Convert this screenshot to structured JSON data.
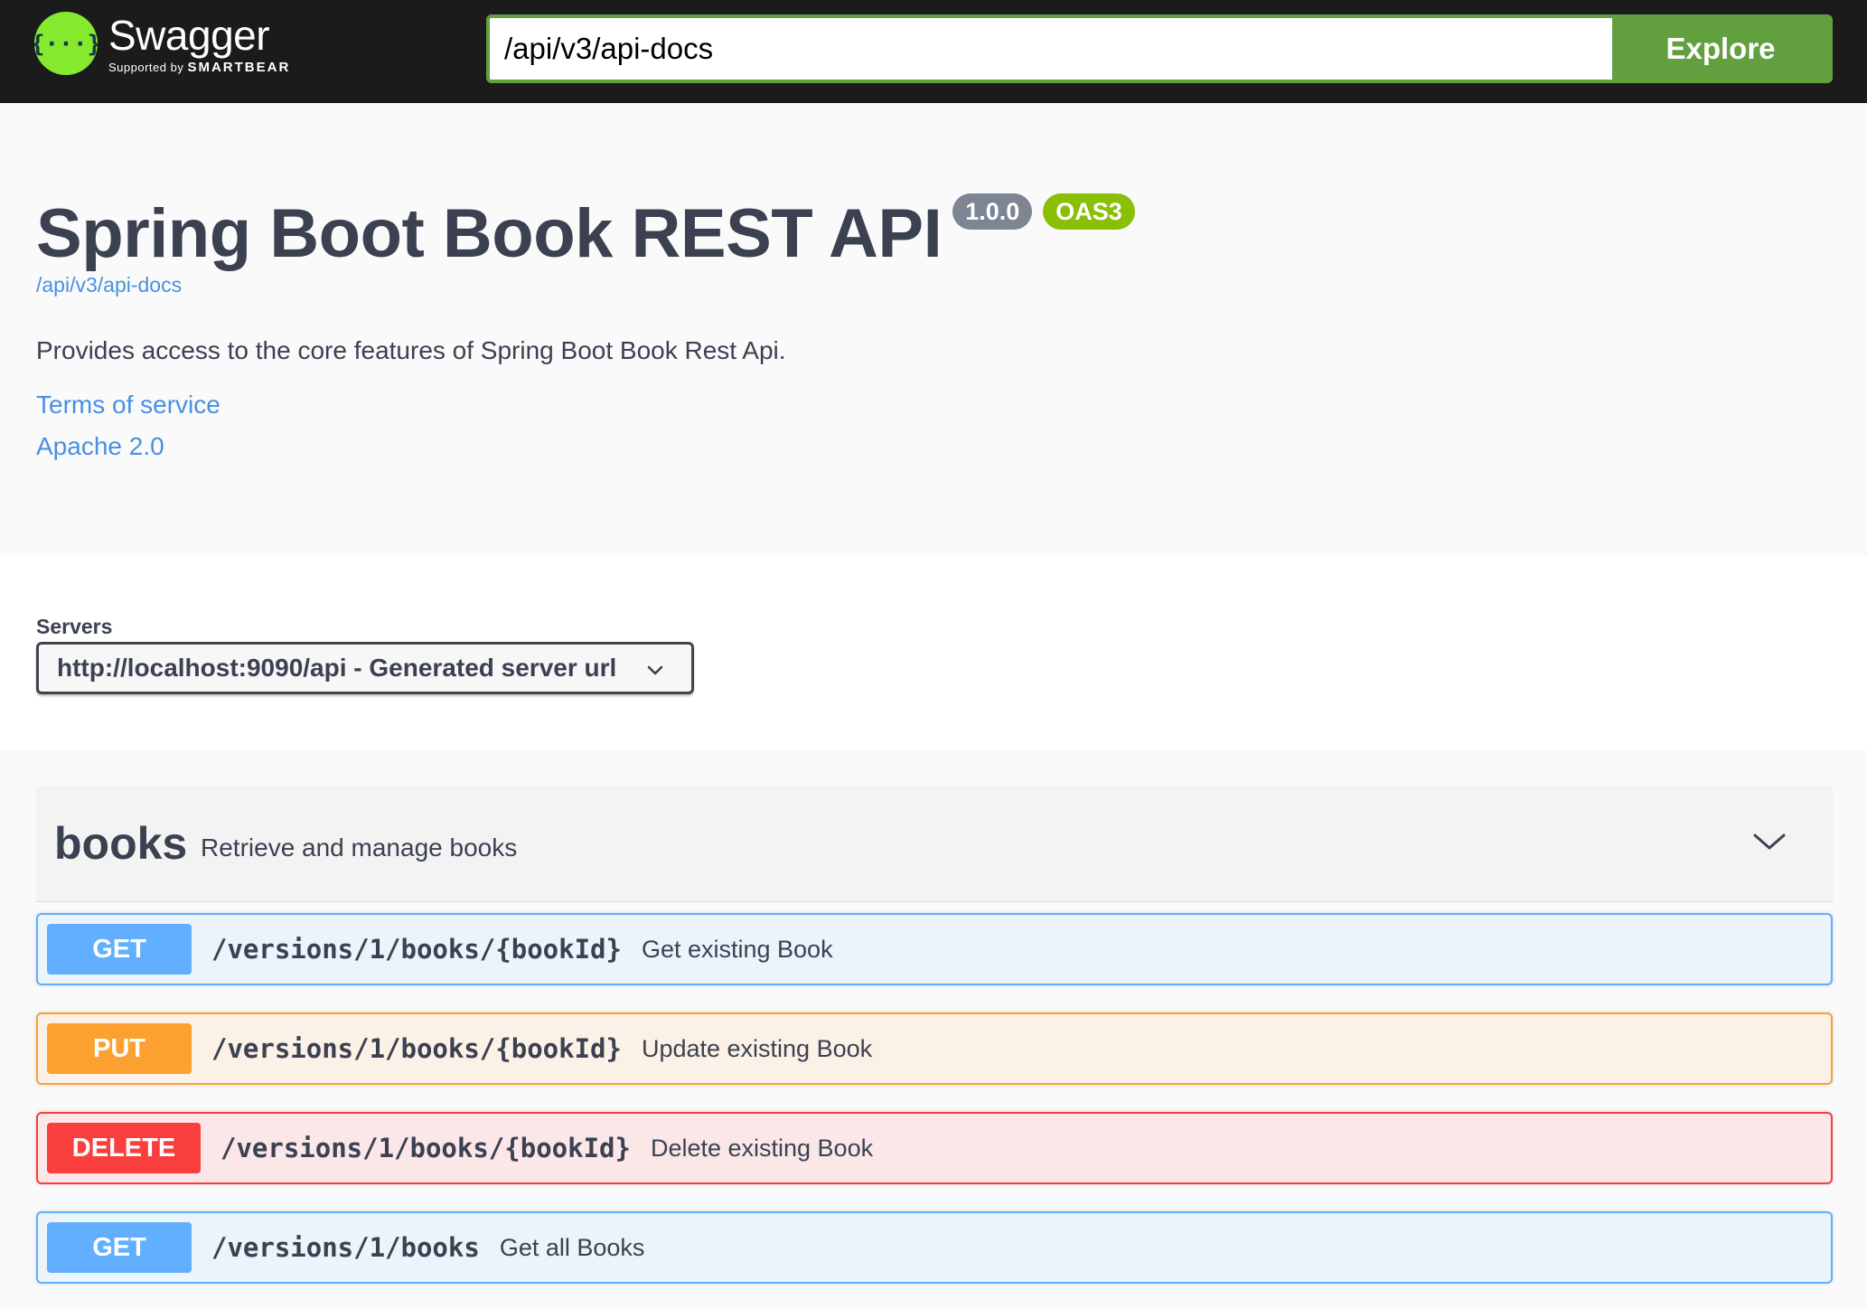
{
  "topbar": {
    "brand_name": "Swagger",
    "brand_sub_prefix": "Supported by",
    "brand_sub_company": "SMARTBEAR",
    "url_value": "/api/v3/api-docs",
    "explore_label": "Explore",
    "accent_color": "#85ea2d",
    "button_color": "#62a03f"
  },
  "info": {
    "title": "Spring Boot Book REST API",
    "version_badge": "1.0.0",
    "oas_badge": "OAS3",
    "spec_url": "/api/v3/api-docs",
    "description": "Provides access to the core features of Spring Boot Book Rest Api.",
    "terms_link": "Terms of service",
    "license_link": "Apache 2.0"
  },
  "servers": {
    "label": "Servers",
    "selected": "http://localhost:9090/api - Generated server url"
  },
  "tag": {
    "name": "books",
    "description": "Retrieve and manage books"
  },
  "operations": [
    {
      "method": "GET",
      "path": "/versions/1/books/{bookId}",
      "summary": "Get existing Book",
      "color": "#61affe"
    },
    {
      "method": "PUT",
      "path": "/versions/1/books/{bookId}",
      "summary": "Update existing Book",
      "color": "#fca130"
    },
    {
      "method": "DELETE",
      "path": "/versions/1/books/{bookId}",
      "summary": "Delete existing Book",
      "color": "#f93e3e"
    },
    {
      "method": "GET",
      "path": "/versions/1/books",
      "summary": "Get all Books",
      "color": "#61affe"
    }
  ]
}
